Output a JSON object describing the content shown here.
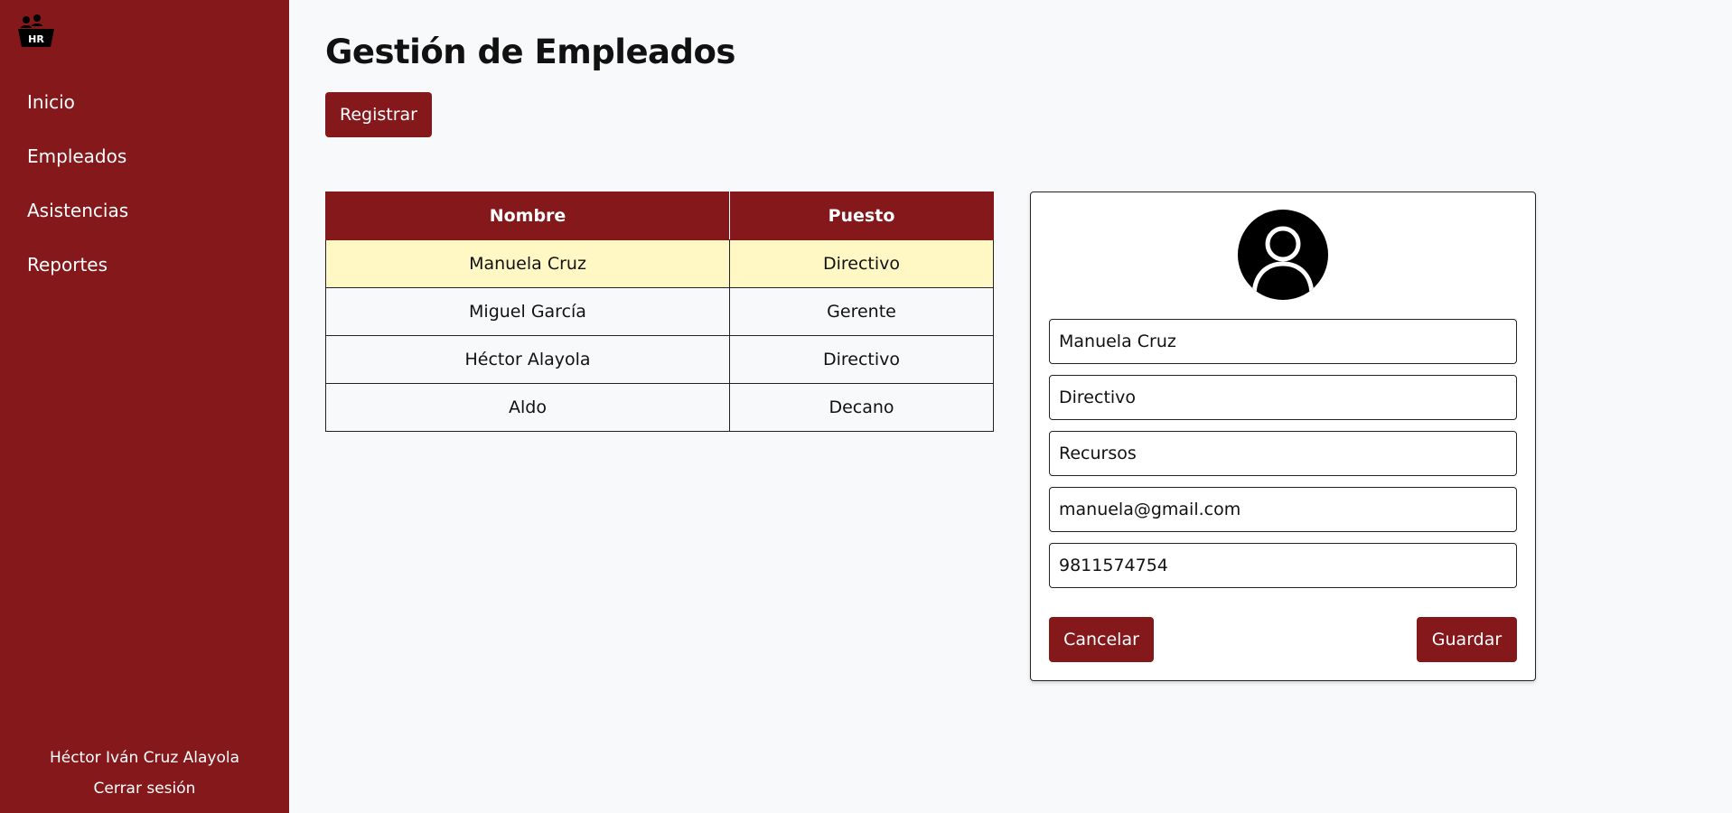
{
  "sidebar": {
    "logo_text": "HR",
    "items": [
      {
        "label": "Inicio"
      },
      {
        "label": "Empleados"
      },
      {
        "label": "Asistencias"
      },
      {
        "label": "Reportes"
      }
    ],
    "user_name": "Héctor Iván Cruz Alayola",
    "logout_label": "Cerrar sesión"
  },
  "main": {
    "title": "Gestión de Empleados",
    "register_label": "Registrar"
  },
  "table": {
    "headers": [
      "Nombre",
      "Puesto"
    ],
    "rows": [
      [
        "Manuela Cruz",
        "Directivo"
      ],
      [
        "Miguel García",
        "Gerente"
      ],
      [
        "Héctor Alayola",
        "Directivo"
      ],
      [
        "Aldo",
        "Decano"
      ]
    ],
    "selected_row": 0
  },
  "form": {
    "avatar_icon": "user-circle-icon",
    "fields": [
      {
        "value": "Manuela Cruz"
      },
      {
        "value": "Directivo"
      },
      {
        "value": "Recursos"
      },
      {
        "value": "manuela@gmail.com"
      },
      {
        "value": "9811574754"
      }
    ],
    "cancel_label": "Cancelar",
    "save_label": "Guardar"
  },
  "colors": {
    "brand": "#84181b",
    "selected_row": "#fff8c4",
    "background": "#f8f9fb"
  }
}
